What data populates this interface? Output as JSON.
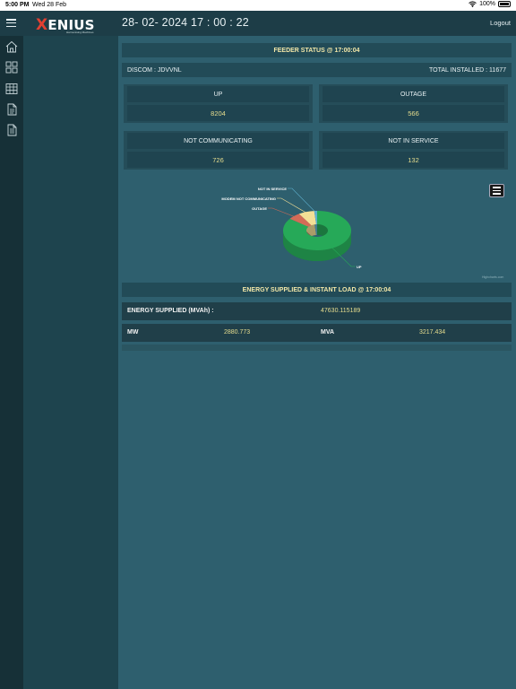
{
  "status_bar": {
    "time": "5:00 PM",
    "date": "Wed 28 Feb",
    "battery": "100%"
  },
  "header": {
    "logo_text": "XENIUS",
    "logo_tagline": "Harmonising Machines",
    "datetime": "28- 02- 2024 17 : 00 : 22",
    "logout_label": "Logout"
  },
  "sidebar": {
    "icons": [
      "home-icon",
      "dashboard-grid-icon",
      "table-icon",
      "report-icon",
      "document-icon"
    ]
  },
  "feeder": {
    "title": "FEEDER STATUS @ 17:00:04",
    "discom_label": "DISCOM : JDVVNL",
    "total_label": "TOTAL INSTALLED : 11677",
    "cards": [
      {
        "label": "UP",
        "value": "8204"
      },
      {
        "label": "OUTAGE",
        "value": "566"
      },
      {
        "label": "NOT COMMUNICATING",
        "value": "726"
      },
      {
        "label": "NOT IN SERVICE",
        "value": "132"
      }
    ]
  },
  "chart_data": {
    "type": "pie",
    "categories": [
      "UP",
      "OUTAGE",
      "MODEM NOT COMMUNICATING",
      "NOT IN SERVICE"
    ],
    "values": [
      8204,
      566,
      726,
      132
    ],
    "colors": [
      "#26a958",
      "#d36b57",
      "#f3df96",
      "#5eb1cf"
    ],
    "credit": "Highcharts.com"
  },
  "energy": {
    "title": "ENERGY SUPPLIED & INSTANT LOAD @ 17:00:04",
    "supplied_label": "ENERGY SUPPLIED (MVAh) :",
    "supplied_value": "47630.115189",
    "mw_label": "MW",
    "mw_value": "2880.773",
    "mva_label": "MVA",
    "mva_value": "3217.434"
  }
}
